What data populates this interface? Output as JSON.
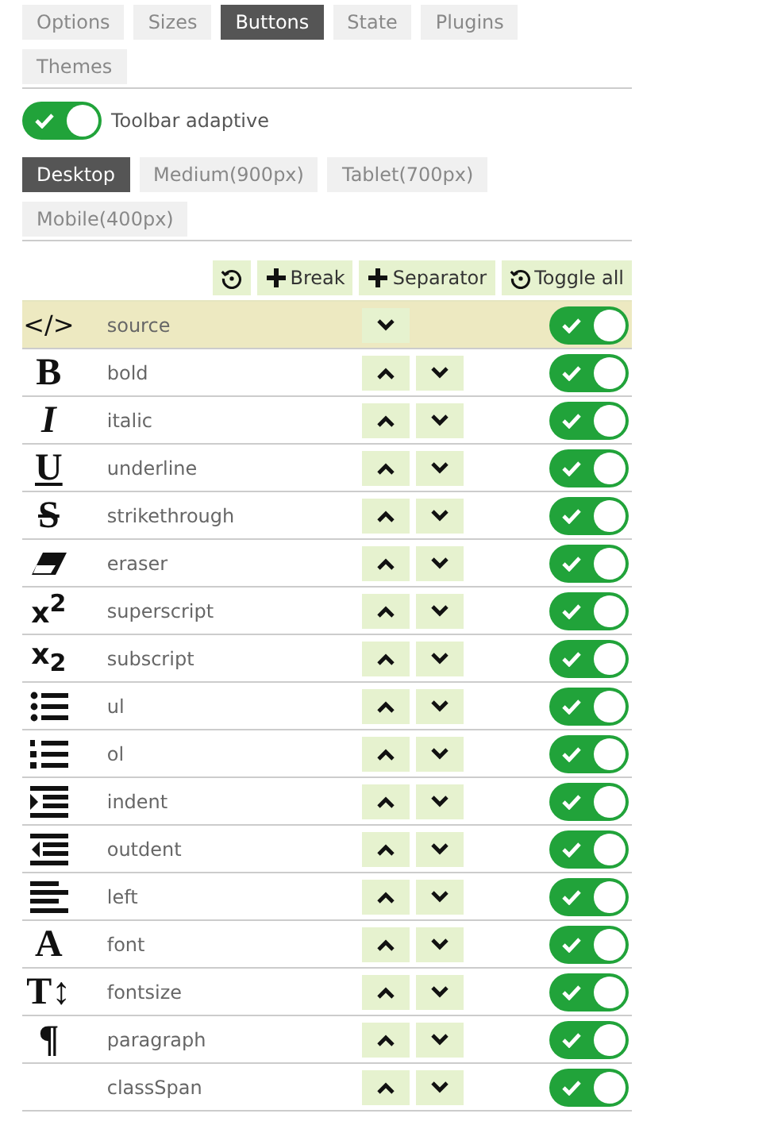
{
  "tabs": [
    {
      "label": "Options",
      "selected": false
    },
    {
      "label": "Sizes",
      "selected": false
    },
    {
      "label": "Buttons",
      "selected": true
    },
    {
      "label": "State",
      "selected": false
    },
    {
      "label": "Plugins",
      "selected": false
    },
    {
      "label": "Themes",
      "selected": false
    }
  ],
  "toolbar_adaptive": {
    "label": "Toolbar adaptive",
    "on": true
  },
  "size_tabs": [
    {
      "label": "Desktop",
      "selected": true
    },
    {
      "label": "Medium(900px)",
      "selected": false
    },
    {
      "label": "Tablet(700px)",
      "selected": false
    },
    {
      "label": "Mobile(400px)",
      "selected": false
    }
  ],
  "actions": [
    {
      "kind": "reset"
    },
    {
      "kind": "add",
      "label": "Break"
    },
    {
      "kind": "add",
      "label": "Separator"
    },
    {
      "kind": "reset",
      "label": "Toggle all"
    }
  ],
  "rows": [
    {
      "name": "source",
      "glyph": "</>",
      "kind": "text",
      "can_move_up": false,
      "selected": true,
      "on": true
    },
    {
      "name": "bold",
      "glyph": "B",
      "kind": "bold",
      "can_move_up": true,
      "selected": false,
      "on": true
    },
    {
      "name": "italic",
      "glyph": "I",
      "kind": "italic",
      "can_move_up": true,
      "selected": false,
      "on": true
    },
    {
      "name": "underline",
      "glyph": "U",
      "kind": "underline",
      "can_move_up": true,
      "selected": false,
      "on": true
    },
    {
      "name": "strikethrough",
      "glyph": "S",
      "kind": "strike",
      "can_move_up": true,
      "selected": false,
      "on": true
    },
    {
      "name": "eraser",
      "kind": "eraser",
      "can_move_up": true,
      "selected": false,
      "on": true
    },
    {
      "name": "superscript",
      "glyph": "x$^{2}$",
      "kind": "script",
      "can_move_up": true,
      "selected": false,
      "on": true
    },
    {
      "name": "subscript",
      "glyph": "x$_{2}$",
      "kind": "script",
      "can_move_up": true,
      "selected": false,
      "on": true
    },
    {
      "name": "ul",
      "kind": "ul",
      "can_move_up": true,
      "selected": false,
      "on": true
    },
    {
      "name": "ol",
      "kind": "ol",
      "can_move_up": true,
      "selected": false,
      "on": true
    },
    {
      "name": "indent",
      "kind": "indent",
      "can_move_up": true,
      "selected": false,
      "on": true
    },
    {
      "name": "outdent",
      "kind": "outdent",
      "can_move_up": true,
      "selected": false,
      "on": true
    },
    {
      "name": "left",
      "kind": "left",
      "can_move_up": true,
      "selected": false,
      "on": true
    },
    {
      "name": "font",
      "glyph": "A",
      "kind": "bold",
      "can_move_up": true,
      "selected": false,
      "on": true
    },
    {
      "name": "fontsize",
      "glyph": "T↕",
      "kind": "bold",
      "can_move_up": true,
      "selected": false,
      "on": true
    },
    {
      "name": "paragraph",
      "glyph": "¶",
      "kind": "bold",
      "can_move_up": true,
      "selected": false,
      "on": true
    },
    {
      "name": "classSpan",
      "kind": "none",
      "can_move_up": true,
      "selected": false,
      "on": true
    }
  ]
}
